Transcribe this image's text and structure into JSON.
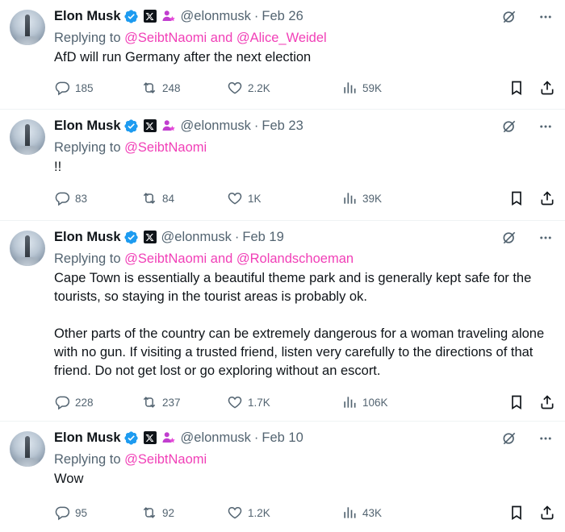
{
  "author": {
    "name": "Elon Musk",
    "handle": "@elonmusk",
    "verified_color": "#1d9bf0"
  },
  "colors": {
    "mention": "#f13fb7",
    "secondary_text": "#536471",
    "primary_text": "#0f1419"
  },
  "tweets": [
    {
      "date": "Feb 26",
      "replying_prefix": "Replying to ",
      "mentions": "@SeibtNaomi and @Alice_Weidel",
      "text": "AfD will run Germany after the next election",
      "replies": "185",
      "reposts": "248",
      "likes": "2.2K",
      "views": "59K",
      "has_affiliate_badge": true
    },
    {
      "date": "Feb 23",
      "replying_prefix": "Replying to ",
      "mentions": "@SeibtNaomi",
      "text": "!!",
      "replies": "83",
      "reposts": "84",
      "likes": "1K",
      "views": "39K",
      "has_affiliate_badge": true
    },
    {
      "date": "Feb 19",
      "replying_prefix": "Replying to ",
      "mentions": "@SeibtNaomi and @Rolandschoeman",
      "text": "Cape Town is essentially a beautiful theme park and is generally kept safe for the tourists, so staying in the tourist areas is probably ok.\n\nOther parts of the country can be extremely dangerous for a woman traveling alone with no gun. If visiting a trusted friend, listen very carefully to the directions of that friend. Do not get lost or go exploring without an escort.",
      "replies": "228",
      "reposts": "237",
      "likes": "1.7K",
      "views": "106K",
      "has_affiliate_badge": false
    },
    {
      "date": "Feb 10",
      "replying_prefix": "Replying to ",
      "mentions": "@SeibtNaomi",
      "text": "Wow",
      "replies": "95",
      "reposts": "92",
      "likes": "1.2K",
      "views": "43K",
      "has_affiliate_badge": true
    }
  ],
  "icons": {
    "verified": "verified-badge-icon",
    "x_logo": "x-logo-icon",
    "affiliate": "affiliate-badge-icon",
    "grok": "grok-icon",
    "more": "more-icon",
    "reply": "reply-icon",
    "repost": "repost-icon",
    "like": "heart-icon",
    "views": "views-icon",
    "bookmark": "bookmark-icon",
    "share": "share-icon"
  }
}
